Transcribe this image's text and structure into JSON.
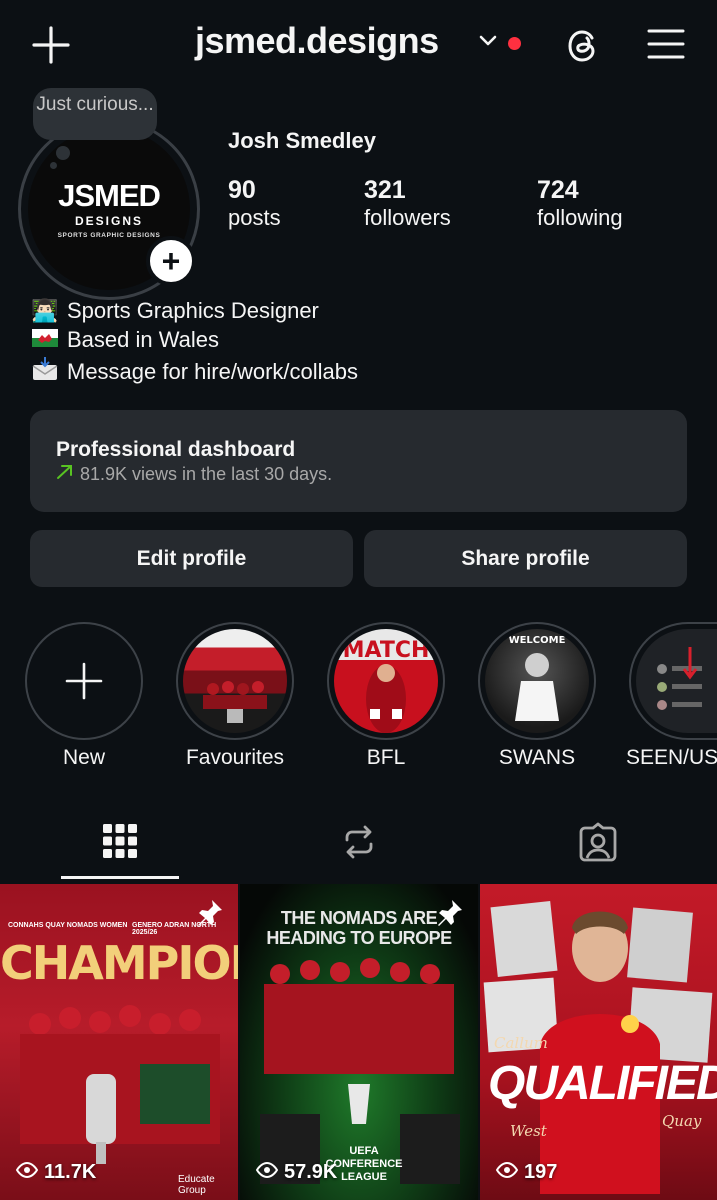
{
  "header": {
    "username": "jsmed.designs"
  },
  "profile": {
    "note": "Just curious...",
    "avatar_logo": {
      "main": "JSMED",
      "sub": "DESIGNS",
      "tagline": "SPORTS GRAPHIC DESIGNS"
    },
    "full_name": "Josh Smedley",
    "stats": {
      "posts": {
        "value": "90",
        "label": "posts"
      },
      "followers": {
        "value": "321",
        "label": "followers"
      },
      "following": {
        "value": "724",
        "label": "following"
      }
    },
    "bio": [
      {
        "emoji": "👨🏻‍💻",
        "text": "Sports Graphics Designer"
      },
      {
        "emoji": "🏴",
        "text": "Based in Wales"
      },
      {
        "emoji": "📩",
        "text": "Message for hire/work/collabs"
      }
    ]
  },
  "dashboard": {
    "title": "Professional dashboard",
    "subtitle": "81.9K views in the last 30 days."
  },
  "buttons": {
    "edit": "Edit profile",
    "share": "Share profile"
  },
  "highlights": [
    {
      "label": "New"
    },
    {
      "label": "Favourites"
    },
    {
      "label": "BFL"
    },
    {
      "label": "SWANS"
    },
    {
      "label": "SEEN/US"
    }
  ],
  "tabs": [
    "posts-grid",
    "reposts",
    "tagged"
  ],
  "posts": [
    {
      "views": "11.7K",
      "pinned": true,
      "title": "CHAMPIONS",
      "top_left": "CONNAHS QUAY NOMADS WOMEN",
      "top_right": "GENERO ADRAN NORTH 2025/26",
      "sponsor": "Educate Group"
    },
    {
      "views": "57.9K",
      "pinned": true,
      "title": "THE NOMADS ARE HEADING TO EUROPE",
      "badge": "UEFA CONFERENCE LEAGUE"
    },
    {
      "views": "197",
      "pinned": false,
      "title": "QUALIFIED",
      "script_left": "Callum",
      "script_left2": "West",
      "script_right": "Quay"
    }
  ],
  "colors": {
    "background": "#0c1014",
    "card": "#262a2f",
    "accent_red": "#ff3040",
    "trend_green": "#58c322"
  }
}
